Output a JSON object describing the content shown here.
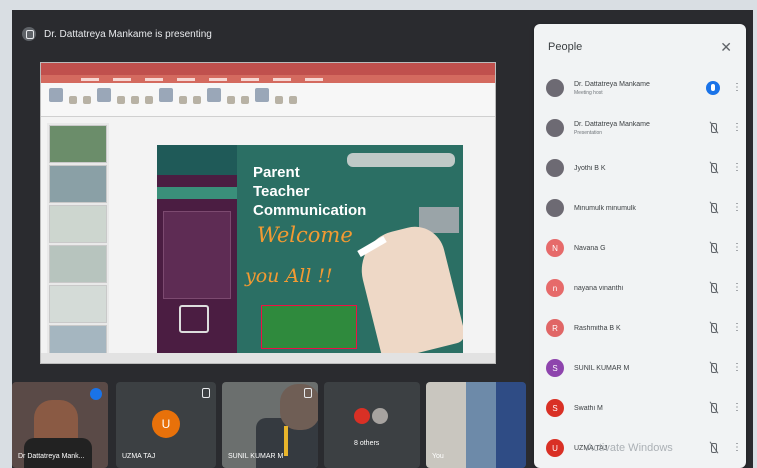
{
  "presenter_bar": {
    "text": "Dr. Dattatreya Mankame is presenting"
  },
  "slide": {
    "heading_line1": "Parent",
    "heading_line2": "Teacher",
    "heading_line3": "Communication",
    "welcome": "Welcome",
    "you_all": "you All !!"
  },
  "panel": {
    "title": "People",
    "close_glyph": "✕",
    "more_glyph": "⋮",
    "participants": [
      {
        "name": "Dr. Dattatreya Mankame",
        "role": "Meeting host",
        "avatar": "photo",
        "mic": "active"
      },
      {
        "name": "Dr. Dattatreya Mankame",
        "role": "Presentation",
        "avatar": "photo",
        "mic": "muted"
      },
      {
        "name": "Jyothi B K",
        "role": "",
        "avatar": "photo",
        "mic": "muted"
      },
      {
        "name": "Minumulk minumulk",
        "role": "",
        "avatar": "photo",
        "mic": "muted"
      },
      {
        "name": "Navana G",
        "role": "",
        "avatar": "letter",
        "letter": "N",
        "color": "#e66a6a",
        "mic": "muted"
      },
      {
        "name": "nayana vinanthi",
        "role": "",
        "avatar": "letter",
        "letter": "n",
        "color": "#e66a6a",
        "mic": "muted"
      },
      {
        "name": "Rashmitha B K",
        "role": "",
        "avatar": "letter",
        "letter": "R",
        "color": "#e06666",
        "mic": "muted"
      },
      {
        "name": "SUNIL KUMAR M",
        "role": "",
        "avatar": "letter",
        "letter": "S",
        "color": "#8e44ad",
        "mic": "muted"
      },
      {
        "name": "Swathi M",
        "role": "",
        "avatar": "letter",
        "letter": "S",
        "color": "#d93025",
        "mic": "muted"
      },
      {
        "name": "UZMA TAJ",
        "role": "",
        "avatar": "letter",
        "letter": "U",
        "color": "#d93025",
        "mic": "muted"
      }
    ],
    "watermark": "Activate Windows"
  },
  "tiles": [
    {
      "name": "Dr Dattatreya Mank...",
      "kind": "camera-presenter",
      "speaking": true
    },
    {
      "name": "UZMA TAJ",
      "kind": "letter",
      "letter": "U"
    },
    {
      "name": "SUNIL KUMAR M",
      "kind": "camera"
    },
    {
      "name": "8 others",
      "kind": "others"
    },
    {
      "name": "You",
      "kind": "camera-self"
    }
  ]
}
